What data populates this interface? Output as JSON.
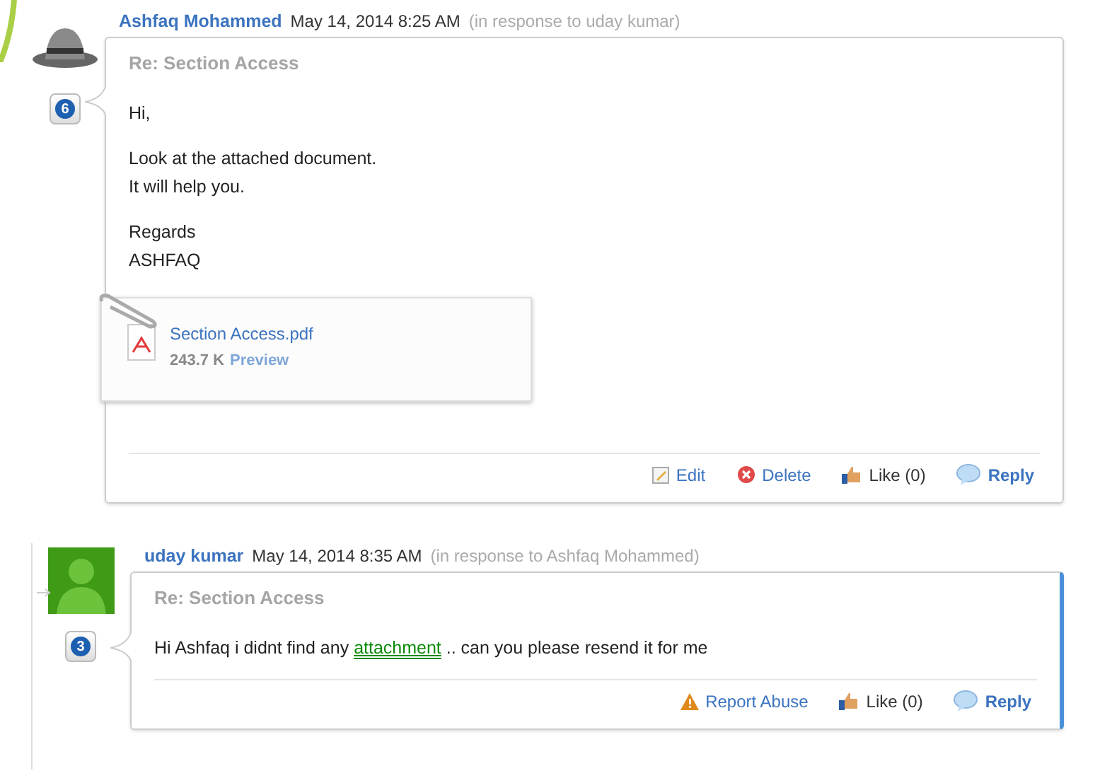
{
  "posts": [
    {
      "author": "Ashfaq Mohammed",
      "date": "May 14, 2014 8:25 AM",
      "in_response": "(in response to uday kumar)",
      "avatar": {
        "kind": "hat"
      },
      "badge": "6",
      "reply": false,
      "highlighted": false,
      "subject": "Re: Section Access",
      "paragraphs": [
        {
          "segments": [
            {
              "kind": "text",
              "text": "Hi,"
            }
          ]
        },
        {
          "segments": [
            {
              "kind": "text",
              "text": "Look at the attached document.\nIt will help you."
            }
          ]
        },
        {
          "segments": [
            {
              "kind": "text",
              "text": "Regards\nASHFAQ"
            }
          ]
        }
      ],
      "attachment": {
        "name": "Section Access.pdf",
        "size": "243.7 K",
        "preview": "Preview"
      },
      "actions": [
        {
          "kind": "edit",
          "label": "Edit"
        },
        {
          "kind": "delete",
          "label": "Delete"
        },
        {
          "kind": "like",
          "label": "Like (0)"
        },
        {
          "kind": "reply",
          "label": "Reply"
        }
      ]
    },
    {
      "author": "uday kumar",
      "date": "May 14, 2014 8:35 AM",
      "in_response": "(in response to Ashfaq Mohammed)",
      "avatar": {
        "kind": "person"
      },
      "badge": "3",
      "reply": true,
      "highlighted": true,
      "subject": "Re: Section Access",
      "paragraphs": [
        {
          "segments": [
            {
              "kind": "text",
              "text": "Hi Ashfaq i didnt find any "
            },
            {
              "kind": "link",
              "text": "attachment"
            },
            {
              "kind": "text",
              "text": " .. can you please resend it for me"
            }
          ]
        }
      ],
      "actions": [
        {
          "kind": "report",
          "label": "Report Abuse"
        },
        {
          "kind": "like",
          "label": "Like (0)"
        },
        {
          "kind": "reply",
          "label": "Reply"
        }
      ]
    }
  ]
}
